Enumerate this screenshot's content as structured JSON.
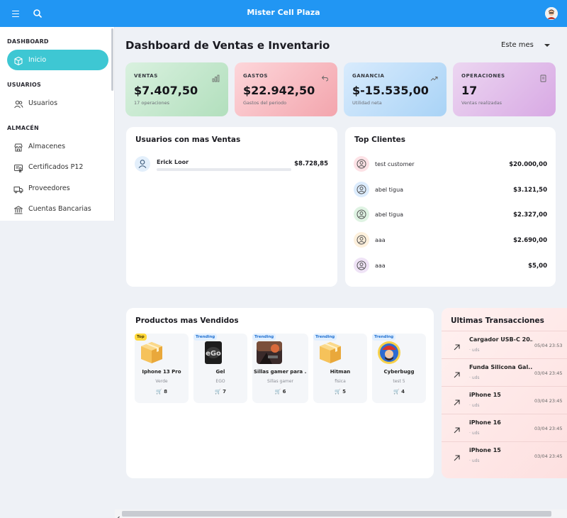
{
  "app": {
    "title": "Mister Cell Plaza",
    "accent_color": "#2196f3",
    "menu_icon": "menu-icon",
    "search_icon": "search-icon",
    "avatar_icon": "user-avatar-icon"
  },
  "sidebar": {
    "sections": [
      {
        "title": "DASHBOARD",
        "items": [
          {
            "label": "Inicio",
            "icon": "cube-icon",
            "active": true
          }
        ]
      },
      {
        "title": "USUARIOS",
        "items": [
          {
            "label": "Usuarios",
            "icon": "users-icon",
            "active": false
          }
        ]
      },
      {
        "title": "ALMACÉN",
        "items": [
          {
            "label": "Almacenes",
            "icon": "store-icon",
            "active": false
          },
          {
            "label": "Certificados P12",
            "icon": "certificate-icon",
            "active": false
          },
          {
            "label": "Proveedores",
            "icon": "truck-icon",
            "active": false
          },
          {
            "label": "Cuentas Bancarias",
            "icon": "bank-icon",
            "active": false
          }
        ]
      }
    ]
  },
  "main": {
    "title": "Dashboard de Ventas e Inventario",
    "period": {
      "selected": "Este mes"
    }
  },
  "stats": [
    {
      "label": "VENTAS",
      "value": "$7.407,50",
      "sub": "17 operaciones",
      "icon": "bar-chart-icon",
      "color": "#b2dfbd"
    },
    {
      "label": "GASTOS",
      "value": "$22.942,50",
      "sub": "Gastos del periodo",
      "icon": "undo-arrow-icon",
      "color": "#f3a5ad"
    },
    {
      "label": "GANANCIA",
      "value": "$-15.535,00",
      "sub": "Utilidad neta",
      "icon": "trending-up-icon",
      "color": "#a9d3f6"
    },
    {
      "label": "OPERACIONES",
      "value": "17",
      "sub": "Ventas realizadas",
      "icon": "receipt-icon",
      "color": "#d8a9e4"
    }
  ],
  "top_users": {
    "title": "Usuarios con mas Ventas",
    "rows": [
      {
        "name": "Erick Loor",
        "amount": "$8.728,85",
        "progress": 1.0
      }
    ]
  },
  "top_clients": {
    "title": "Top Clientes",
    "rows": [
      {
        "name": "test customer",
        "amount": "$20.000,00",
        "color": "#fde2e6"
      },
      {
        "name": "abel tigua",
        "amount": "$3.121,50",
        "color": "#dcecfd"
      },
      {
        "name": "abel tigua",
        "amount": "$2.327,00",
        "color": "#dff3e3"
      },
      {
        "name": "aaa",
        "amount": "$2.690,00",
        "color": "#fdf0dc"
      },
      {
        "name": "aaa",
        "amount": "$5,00",
        "color": "#efe3f6"
      }
    ]
  },
  "products": {
    "title": "Productos mas Vendidos",
    "items": [
      {
        "badge": "Top",
        "badge_type": "top",
        "name": "Iphone 13 Pro",
        "category": "Verde",
        "qty": "8",
        "image": "box-icon"
      },
      {
        "badge": "Trending",
        "badge_type": "trend",
        "name": "Gel",
        "category": "EGO",
        "qty": "7",
        "image": "gel-product-image"
      },
      {
        "badge": "Trending",
        "badge_type": "trend",
        "name": "Sillas gamer para ...",
        "category": "Sillas gamer",
        "qty": "6",
        "image": "game-image"
      },
      {
        "badge": "Trending",
        "badge_type": "trend",
        "name": "Hitman",
        "category": "fisica",
        "qty": "5",
        "image": "box-icon"
      },
      {
        "badge": "Trending",
        "badge_type": "trend",
        "name": "Cyberbugg",
        "category": "test 5",
        "qty": "4",
        "image": "character-image"
      }
    ]
  },
  "transactions": {
    "title": "Ultimas Transacciones",
    "rows": [
      {
        "name": "Cargador USB-C 20...",
        "sub": "· uds",
        "date": "05/04 23:53"
      },
      {
        "name": "Funda Silicona Gal...",
        "sub": "· uds",
        "date": "03/04 23:45"
      },
      {
        "name": "iPhone 15",
        "sub": "· uds",
        "date": "03/04 23:45"
      },
      {
        "name": "iPhone 16",
        "sub": "· uds",
        "date": "03/04 23:45"
      },
      {
        "name": "iPhone 15",
        "sub": "· uds",
        "date": "03/04 23:45"
      }
    ]
  }
}
